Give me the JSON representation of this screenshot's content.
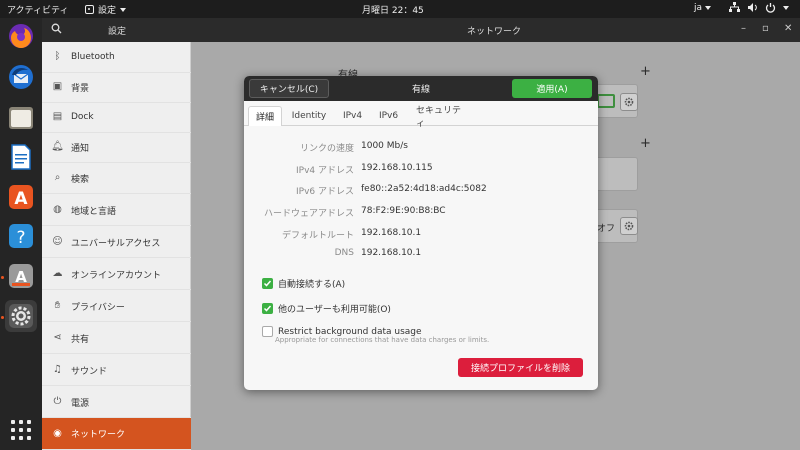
{
  "topbar": {
    "activities": "アクティビティ",
    "app_name": "設定",
    "clock": "月曜日 22：45",
    "language": "ja"
  },
  "dock": {
    "items": [
      "firefox-icon",
      "thunderbird-icon",
      "files-icon",
      "writer-icon",
      "software-icon",
      "help-icon",
      "software-updater-icon",
      "settings-icon"
    ],
    "show_apps": "app-grid-icon"
  },
  "header": {
    "left_title": "設定",
    "right_title": "ネットワーク"
  },
  "sidebar": {
    "items": [
      {
        "label": "Bluetooth",
        "icon": "bluetooth-icon"
      },
      {
        "label": "背景",
        "icon": "background-icon"
      },
      {
        "label": "Dock",
        "icon": "dock-icon"
      },
      {
        "label": "通知",
        "icon": "bell-icon"
      },
      {
        "label": "検索",
        "icon": "search-icon"
      },
      {
        "label": "地域と言語",
        "icon": "globe-icon"
      },
      {
        "label": "ユニバーサルアクセス",
        "icon": "accessibility-icon"
      },
      {
        "label": "オンラインアカウント",
        "icon": "cloud-icon"
      },
      {
        "label": "プライバシー",
        "icon": "hand-icon"
      },
      {
        "label": "共有",
        "icon": "share-icon"
      },
      {
        "label": "サウンド",
        "icon": "music-icon"
      },
      {
        "label": "電源",
        "icon": "power-icon"
      },
      {
        "label": "ネットワーク",
        "icon": "network-icon"
      }
    ],
    "selected": "ネットワーク"
  },
  "background_panel": {
    "section_title": "有線",
    "proxy_value_partial": "オフ"
  },
  "dialog": {
    "title": "有線",
    "cancel_label": "キャンセル(C)",
    "apply_label": "適用(A)",
    "tabs": [
      "詳細",
      "Identity",
      "IPv4",
      "IPv6",
      "セキュリティ"
    ],
    "active_tab": "詳細",
    "details": [
      {
        "label": "リンクの速度",
        "value": "1000 Mb/s"
      },
      {
        "label": "IPv4 アドレス",
        "value": "192.168.10.115"
      },
      {
        "label": "IPv6 アドレス",
        "value": "fe80::2a52:4d18:ad4c:5082"
      },
      {
        "label": "ハードウェアアドレス",
        "value": "78:F2:9E:90:B8:BC"
      },
      {
        "label": "デフォルトルート",
        "value": "192.168.10.1"
      },
      {
        "label": "DNS",
        "value": "192.168.10.1"
      }
    ],
    "auto_connect": {
      "label": "自動接続する(A)",
      "checked": true
    },
    "all_users": {
      "label": "他のユーザーも利用可能(O)",
      "checked": true
    },
    "restrict": {
      "label": "Restrict background data usage",
      "sublabel": "Appropriate for connections that have data charges or limits.",
      "checked": false
    },
    "delete_label": "接続プロファイルを削除"
  },
  "colors": {
    "accent": "#d4541f",
    "apply": "#3cb043",
    "delete": "#dc1e3c"
  }
}
